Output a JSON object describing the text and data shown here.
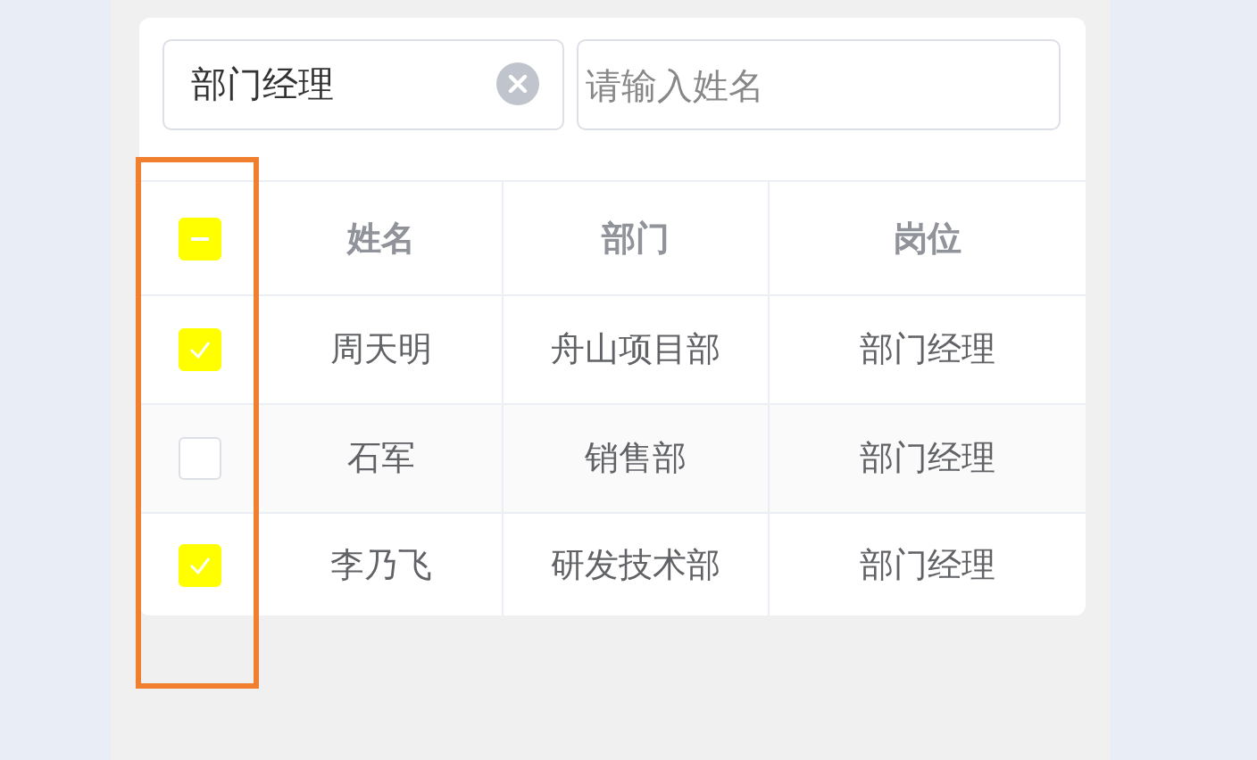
{
  "filters": [
    {
      "value": "部门经理",
      "clearable": true
    },
    {
      "placeholder": "请输入姓名"
    }
  ],
  "table": {
    "select_all": {
      "indeterminate": true
    },
    "columns": [
      "姓名",
      "部门",
      "岗位"
    ],
    "rows": [
      {
        "checked": true,
        "cells": [
          "周天明",
          "舟山项目部",
          "部门经理"
        ]
      },
      {
        "checked": false,
        "cells": [
          "石军",
          "销售部",
          "部门经理"
        ]
      },
      {
        "checked": true,
        "cells": [
          "李乃飞",
          "研发技术部",
          "部门经理"
        ]
      }
    ]
  }
}
